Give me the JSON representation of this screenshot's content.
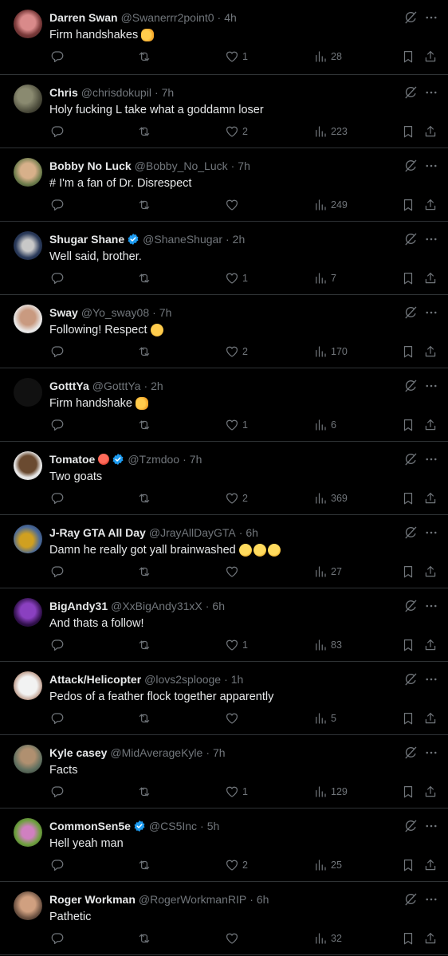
{
  "colors": {
    "background": "#000000",
    "text": "#e7e9ea",
    "muted": "#71767b",
    "verified": "#1d9bf0",
    "divider": "#2f3336"
  },
  "icons": {
    "reply": "reply-icon",
    "retweet": "retweet-icon",
    "like": "heart-icon",
    "views": "views-icon",
    "bookmark": "bookmark-icon",
    "share": "share-icon",
    "grok": "grok-icon",
    "more": "more-icon"
  },
  "tweets": [
    {
      "name": "Darren Swan",
      "handle": "@Swanerrr2point0",
      "time": "4h",
      "text": "Firm handshakes",
      "text_emoji": [
        "handshake"
      ],
      "likes": "1",
      "views": "28",
      "verified": false
    },
    {
      "name": "Chris",
      "handle": "@chrisdokupil",
      "time": "7h",
      "text": "Holy fucking L take what a goddamn loser",
      "text_emoji": [],
      "likes": "2",
      "views": "223",
      "verified": false
    },
    {
      "name": "Bobby No Luck",
      "handle": "@Bobby_No_Luck",
      "time": "7h",
      "text": "# I'm a fan of Dr. Disrespect",
      "text_emoji": [],
      "likes": "",
      "views": "249",
      "verified": false
    },
    {
      "name": "Shugar Shane",
      "handle": "@ShaneShugar",
      "time": "2h",
      "text": "Well said, brother.",
      "text_emoji": [],
      "likes": "1",
      "views": "7",
      "verified": true
    },
    {
      "name": "Sway",
      "handle": "@Yo_sway08",
      "time": "7h",
      "text": "Following! Respect",
      "text_emoji": [
        "saluting-face"
      ],
      "likes": "2",
      "views": "170",
      "verified": false
    },
    {
      "name": "GotttYa",
      "handle": "@GotttYa",
      "time": "2h",
      "text": "Firm handshake",
      "text_emoji": [
        "handshake"
      ],
      "likes": "1",
      "views": "6",
      "verified": false
    },
    {
      "name": "Tomatoe",
      "handle": "@Tzmdoo",
      "time": "7h",
      "text": "Two goats",
      "text_emoji": [],
      "likes": "2",
      "views": "369",
      "verified": true,
      "name_emoji": "tomato"
    },
    {
      "name": "J-Ray GTA All Day",
      "handle": "@JrayAllDayGTA",
      "time": "6h",
      "text": "Damn he really got yall brainwashed",
      "text_emoji": [
        "rofl",
        "rofl",
        "rofl"
      ],
      "likes": "",
      "views": "27",
      "verified": false
    },
    {
      "name": "BigAndy31",
      "handle": "@XxBigAndy31xX",
      "time": "6h",
      "text": "And thats a follow!",
      "text_emoji": [],
      "likes": "1",
      "views": "83",
      "verified": false
    },
    {
      "name": "Attack/Helicopter",
      "handle": "@lovs2splooge",
      "time": "1h",
      "text": "Pedos of a feather flock together apparently",
      "text_emoji": [],
      "likes": "",
      "views": "5",
      "verified": false
    },
    {
      "name": "Kyle casey",
      "handle": "@MidAverageKyle",
      "time": "7h",
      "text": "Facts",
      "text_emoji": [],
      "likes": "1",
      "views": "129",
      "verified": false
    },
    {
      "name": "CommonSen5e",
      "handle": "@CS5Inc",
      "time": "5h",
      "text": "Hell yeah man",
      "text_emoji": [],
      "likes": "2",
      "views": "25",
      "verified": true
    },
    {
      "name": "Roger Workman",
      "handle": "@RogerWorkmanRIP",
      "time": "6h",
      "text": "Pathetic",
      "text_emoji": [],
      "likes": "",
      "views": "32",
      "verified": false
    }
  ]
}
